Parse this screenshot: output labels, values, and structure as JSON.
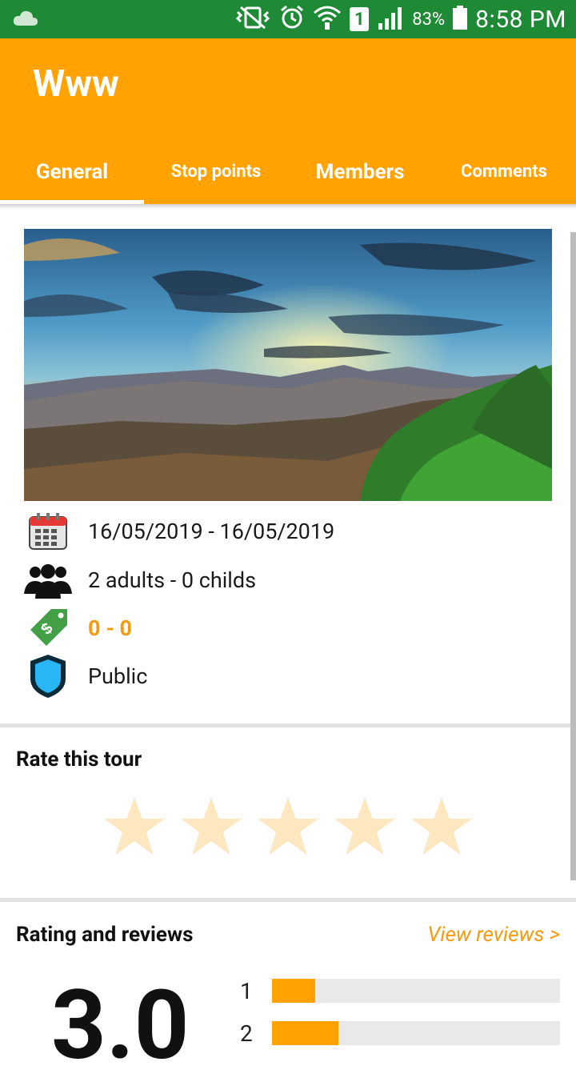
{
  "status_bar": {
    "battery": "83%",
    "time": "8:58 PM",
    "sim_slot": "1",
    "icons": [
      "cloud-icon",
      "vibrate-icon",
      "alarm-icon",
      "wifi-icon",
      "sim-icon",
      "signal-icon",
      "battery-icon"
    ]
  },
  "app_bar": {
    "title": "Www"
  },
  "tabs": [
    {
      "label": "General",
      "active": true
    },
    {
      "label": "Stop points",
      "active": false
    },
    {
      "label": "Members",
      "active": false
    },
    {
      "label": "Comments",
      "active": false
    }
  ],
  "info": {
    "dates": "16/05/2019 - 16/05/2019",
    "people": "2 adults - 0 childs",
    "price": "0 - 0",
    "visibility": "Public"
  },
  "rate": {
    "title": "Rate this tour",
    "star_count": 5,
    "star_color": "#fde7c0"
  },
  "reviews": {
    "title": "Rating and reviews",
    "link": "View reviews >",
    "score": "3.0",
    "bars": [
      {
        "label": "1",
        "fraction": 0.15
      },
      {
        "label": "2",
        "fraction": 0.23
      }
    ]
  },
  "colors": {
    "accent": "#ffa202",
    "status_bar": "#1e8a35",
    "price": "#f39c12"
  }
}
